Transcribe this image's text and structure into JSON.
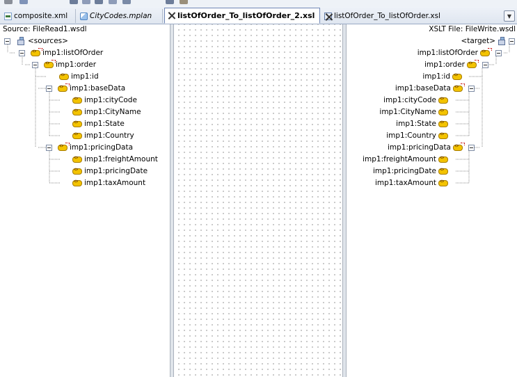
{
  "editor_tabs": [
    {
      "label": "composite.xml",
      "icon": "xml-file-icon",
      "active": false
    },
    {
      "label": "CityCodes.mplan",
      "icon": "mplan-file-icon",
      "active": false
    },
    {
      "label": "listOfOrder_To_listOfOrder_2.xsl",
      "icon": "xsl-map-icon",
      "active": true
    },
    {
      "label": "listOfOrder_To_listOfOrder.xsl",
      "icon": "xsl-map-icon",
      "active": false
    }
  ],
  "source_panel": {
    "header": "Source: FileRead1.wsdl",
    "tree": [
      {
        "label": "<sources>",
        "icon": "sources-icon"
      },
      {
        "label": "imp1:listOfOrder",
        "icon": "element-icon"
      },
      {
        "label": "imp1:order",
        "icon": "element-icon"
      },
      {
        "label": "imp1:id",
        "icon": "element-icon"
      },
      {
        "label": "imp1:baseData",
        "icon": "element-icon"
      },
      {
        "label": "imp1:cityCode",
        "icon": "element-icon"
      },
      {
        "label": "imp1:CityName",
        "icon": "element-icon"
      },
      {
        "label": "imp1:State",
        "icon": "element-icon"
      },
      {
        "label": "imp1:Country",
        "icon": "element-icon"
      },
      {
        "label": "imp1:pricingData",
        "icon": "element-icon"
      },
      {
        "label": "imp1:freightAmount",
        "icon": "element-icon"
      },
      {
        "label": "imp1:pricingDate",
        "icon": "element-icon"
      },
      {
        "label": "imp1:taxAmount",
        "icon": "element-icon"
      }
    ]
  },
  "target_panel": {
    "header": "XSLT File: FileWrite.wsdl",
    "tree": [
      {
        "label": "<target>",
        "icon": "target-icon"
      },
      {
        "label": "imp1:listOfOrder",
        "icon": "element-icon"
      },
      {
        "label": "imp1:order",
        "icon": "element-icon"
      },
      {
        "label": "imp1:id",
        "icon": "element-icon"
      },
      {
        "label": "imp1:baseData",
        "icon": "element-icon"
      },
      {
        "label": "imp1:cityCode",
        "icon": "element-icon"
      },
      {
        "label": "imp1:CityName",
        "icon": "element-icon"
      },
      {
        "label": "imp1:State",
        "icon": "element-icon"
      },
      {
        "label": "imp1:Country",
        "icon": "element-icon"
      },
      {
        "label": "imp1:pricingData",
        "icon": "element-icon"
      },
      {
        "label": "imp1:freightAmount",
        "icon": "element-icon"
      },
      {
        "label": "imp1:pricingDate",
        "icon": "element-icon"
      },
      {
        "label": "imp1:taxAmount",
        "icon": "element-icon"
      }
    ]
  },
  "colors": {
    "tab_bar": "#dfe6f0",
    "active_tab_border": "#6f86b5",
    "element_icon": "#f3c300",
    "canvas_dots": "#a7a7a7"
  }
}
